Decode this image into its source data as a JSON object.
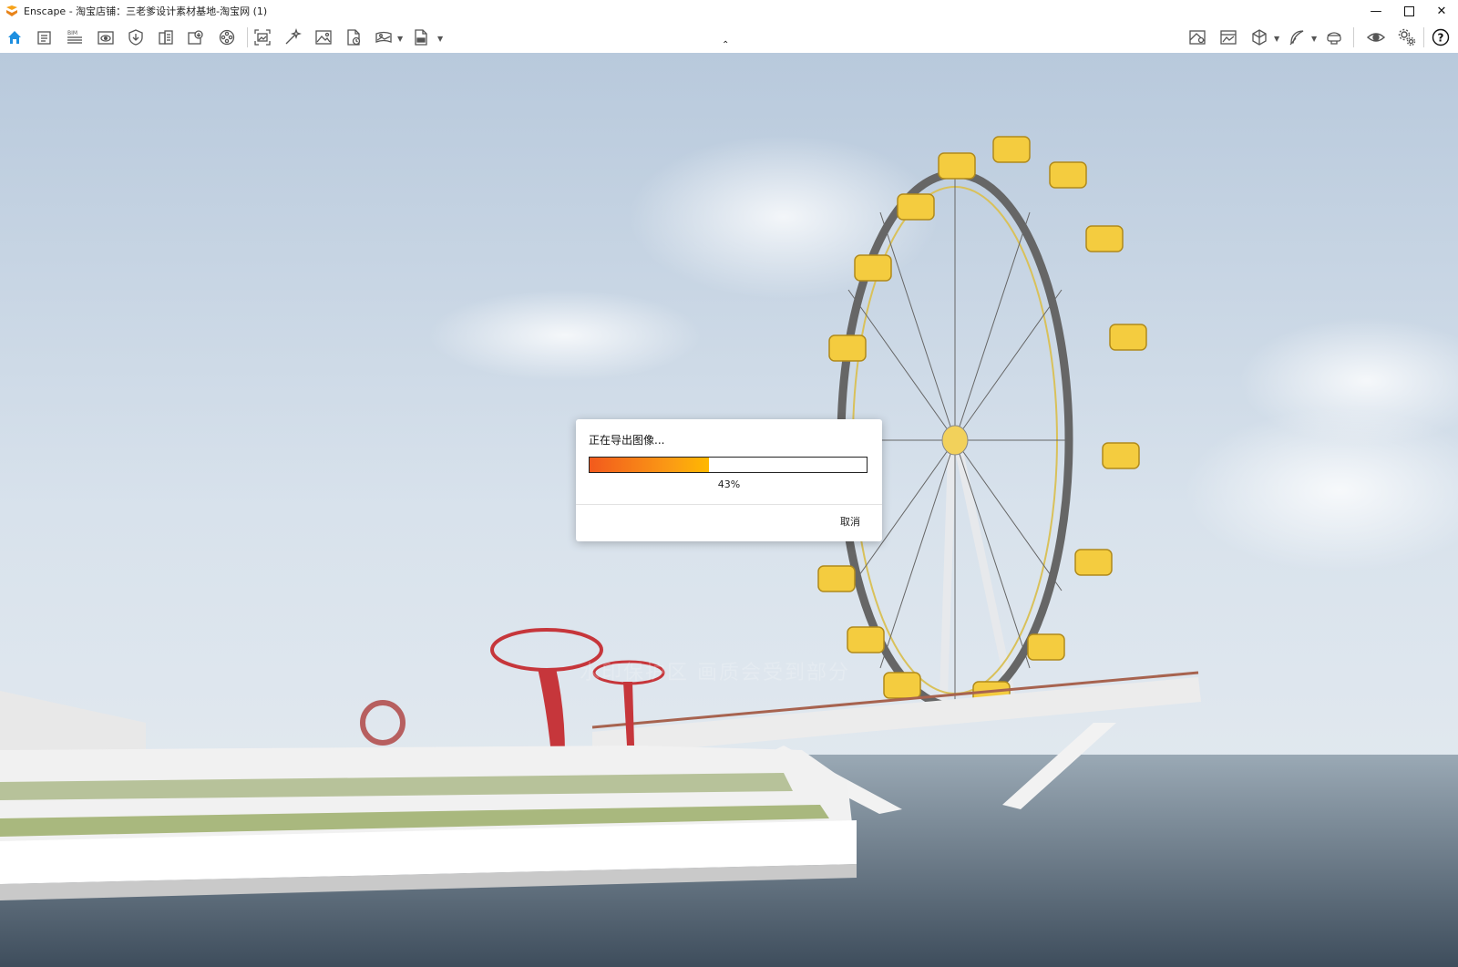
{
  "window": {
    "title": "Enscape - 淘宝店铺：三老爹设计素材基地-淘宝网 (1)",
    "controls": [
      "minimize-icon",
      "maximize-icon",
      "close-icon"
    ]
  },
  "toolbar": {
    "left_icons": [
      "home-icon",
      "document-icon",
      "bim-icon",
      "view-icon",
      "shield-icon",
      "building-icon",
      "export-icon",
      "film-reel-icon",
      "screenshot-icon",
      "magic-wand-icon",
      "image-icon",
      "batch-render-icon",
      "panorama-icon",
      "export-file-icon"
    ],
    "bim_label": "BIM",
    "right_icons": [
      "map-icon",
      "gallery-icon",
      "cube-icon",
      "feather-icon",
      "vr-headset-icon",
      "eye-icon",
      "settings-icon",
      "help-icon"
    ],
    "help_glyph": "?",
    "collapse_glyph": "⌃"
  },
  "viewport": {
    "watermark": "水印保护区 画质会受到部分"
  },
  "dialog": {
    "title": "正在导出图像...",
    "progress": 0.43,
    "progress_text": "43%",
    "cancel_label": "取消"
  }
}
